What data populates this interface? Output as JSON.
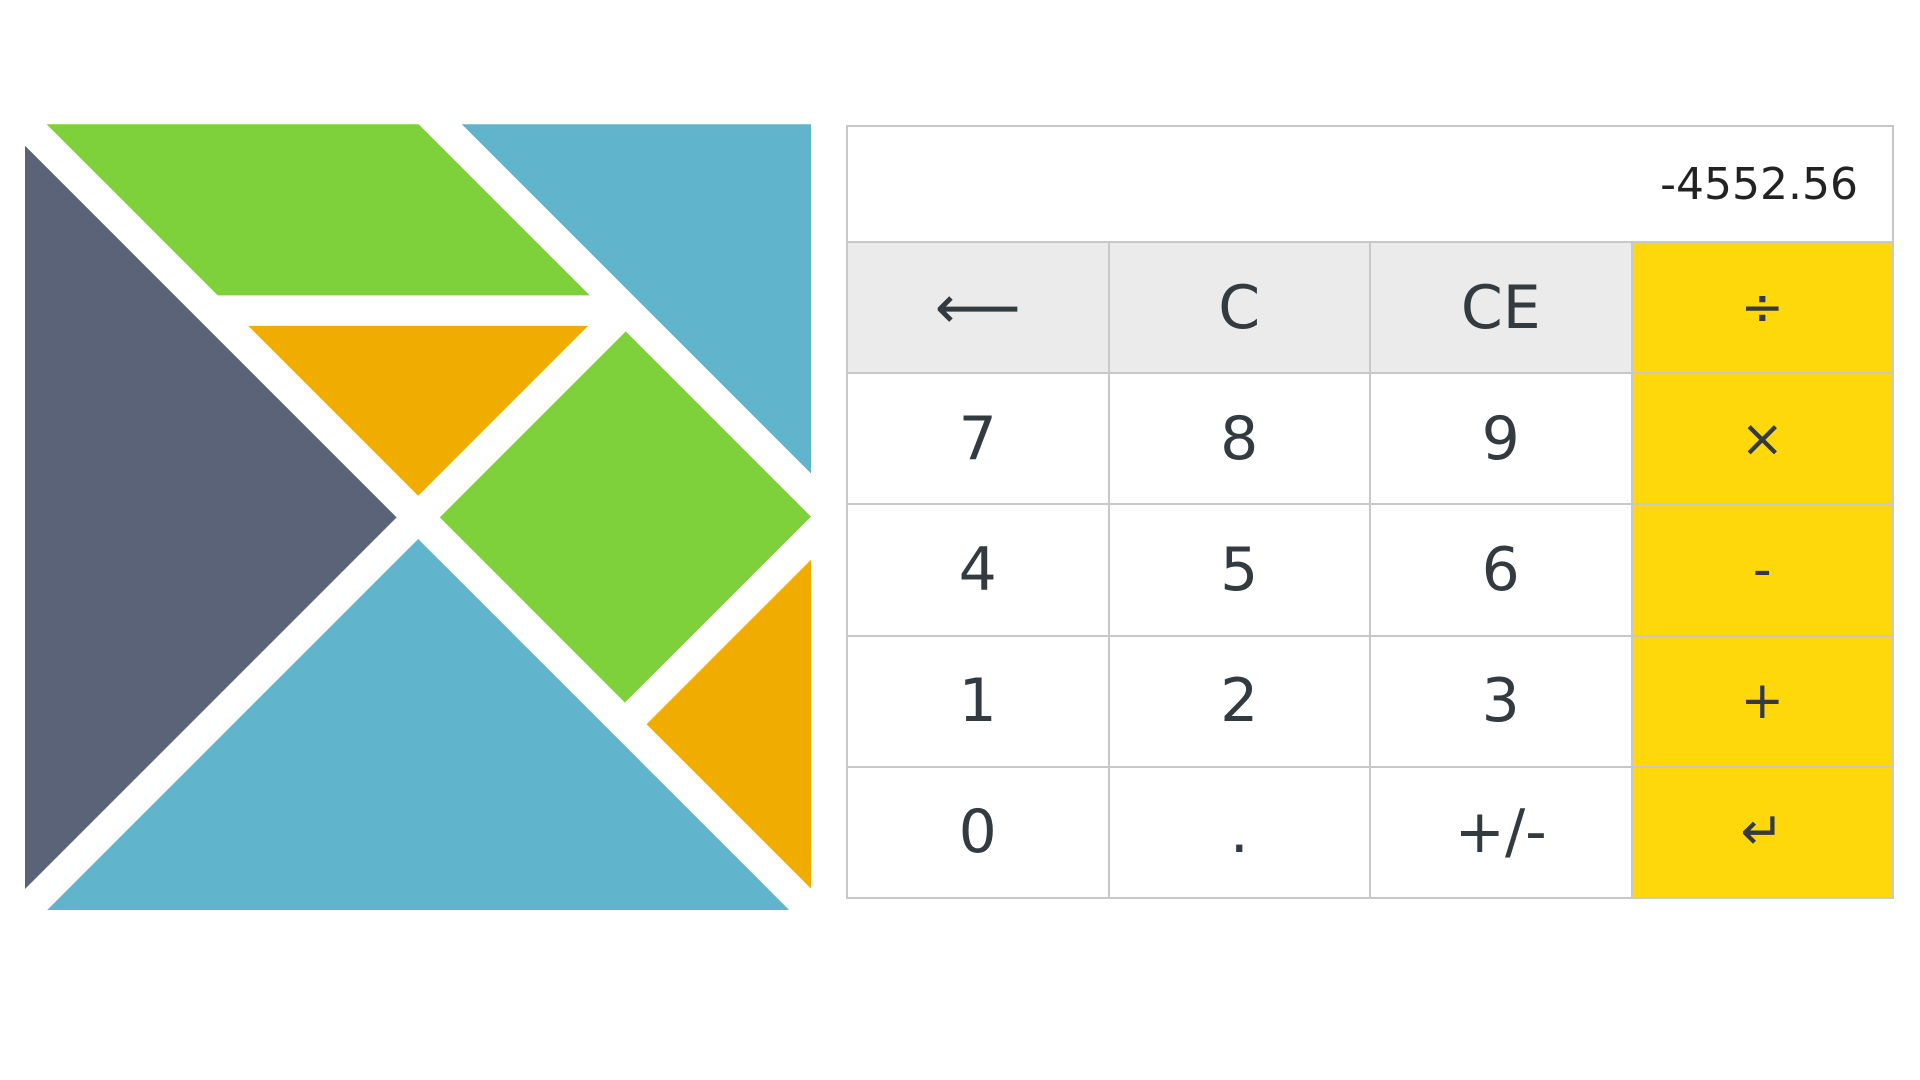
{
  "colors": {
    "logo_gray": "#5a6378",
    "logo_green": "#7fd13b",
    "logo_blue": "#60b5cc",
    "logo_orange": "#f0ad00",
    "operator_key": "#ffd80b",
    "function_key": "#ebebeb",
    "number_key": "#ffffff"
  },
  "logo": {
    "icon": "elm-tangram-logo"
  },
  "display": {
    "value": "-4552.56"
  },
  "keys": {
    "backspace": "⟵",
    "clear": "C",
    "clear_entry": "CE",
    "divide": "÷",
    "seven": "7",
    "eight": "8",
    "nine": "9",
    "multiply": "×",
    "four": "4",
    "five": "5",
    "six": "6",
    "subtract": "-",
    "one": "1",
    "two": "2",
    "three": "3",
    "add": "+",
    "zero": "0",
    "decimal": ".",
    "negate": "+/-",
    "enter": "↵"
  }
}
